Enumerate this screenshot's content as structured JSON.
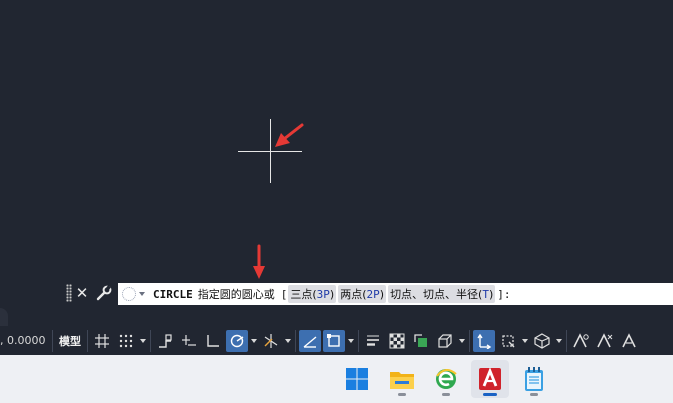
{
  "command_line": {
    "command_name": "CIRCLE",
    "prompt": "指定圆的圆心或",
    "bracket_open": "[",
    "options": [
      {
        "label": "三点(",
        "key": "3P",
        "close": ")"
      },
      {
        "label": "两点(",
        "key": "2P",
        "close": ")"
      },
      {
        "label": "切点、切点、半径(",
        "key": "T",
        "close": ")"
      }
    ],
    "tail": "]:",
    "close_glyph": "✕"
  },
  "status_bar": {
    "coordinates": ", 0.0000",
    "model_label": "模型"
  },
  "colors": {
    "canvas": "#212631",
    "annotation_arrow": "#e53935",
    "toggle_on": "#3d6fb0",
    "option_key": "#1f3aa8"
  },
  "taskbar": {
    "apps": [
      "windows-start-icon",
      "file-explorer-icon",
      "browser-icon",
      "autocad-icon",
      "notepad-icon"
    ],
    "active_app": "autocad-icon"
  }
}
